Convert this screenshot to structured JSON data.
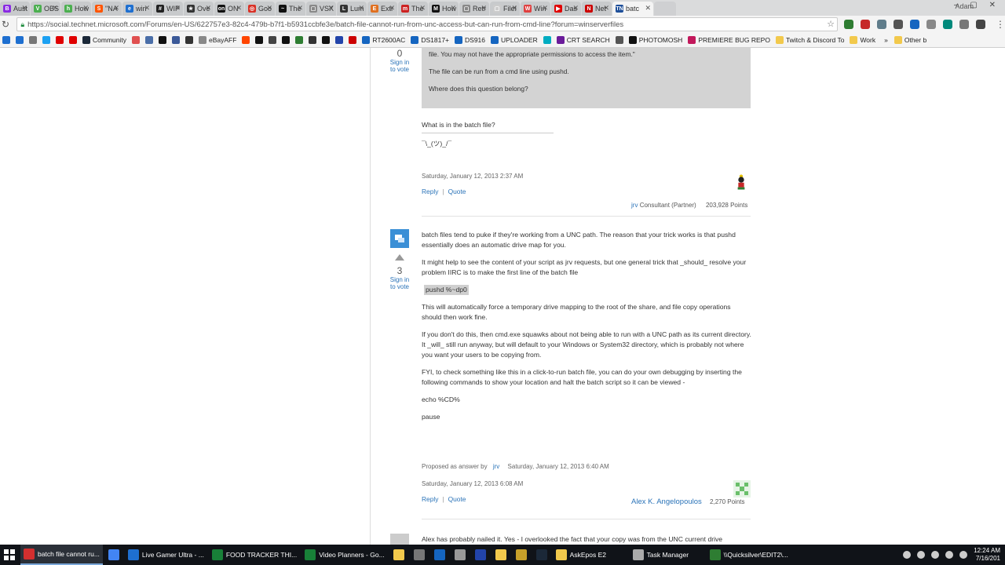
{
  "browser": {
    "tabs": [
      {
        "label": "Aust",
        "color": "#8a2be2",
        "glyph": "B"
      },
      {
        "label": "OBS",
        "color": "#4caf50",
        "glyph": "V"
      },
      {
        "label": "How",
        "color": "#4caf50",
        "glyph": "h"
      },
      {
        "label": "\"NA",
        "color": "#ff5500",
        "glyph": "S"
      },
      {
        "label": "win",
        "color": "#1e6fd0",
        "glyph": "e"
      },
      {
        "label": "WIP",
        "color": "#222222",
        "glyph": "#"
      },
      {
        "label": "Ove",
        "color": "#333333",
        "glyph": "★"
      },
      {
        "label": "ON",
        "color": "#111111",
        "glyph": "on"
      },
      {
        "label": "Goo",
        "color": "#d93025",
        "glyph": "◎"
      },
      {
        "label": "The",
        "color": "#111111",
        "glyph": "~"
      },
      {
        "label": "VSX",
        "color": "#888888",
        "glyph": "▢"
      },
      {
        "label": "Lum",
        "color": "#333333",
        "glyph": "L"
      },
      {
        "label": "Extr",
        "color": "#e07020",
        "glyph": "E"
      },
      {
        "label": "The",
        "color": "#cc2222",
        "glyph": "m"
      },
      {
        "label": "How",
        "color": "#111111",
        "glyph": "M"
      },
      {
        "label": "Retr",
        "color": "#888888",
        "glyph": "▢"
      },
      {
        "label": "FileI",
        "color": "#cccccc",
        "glyph": "▢"
      },
      {
        "label": "Win",
        "color": "#e04040",
        "glyph": "W"
      },
      {
        "label": "Das",
        "color": "#e00000",
        "glyph": "▶"
      },
      {
        "label": "Net",
        "color": "#cc0000",
        "glyph": "N"
      },
      {
        "label": "batc",
        "color": "#1e4f9a",
        "glyph": "TN"
      }
    ],
    "profile_name": "Adam",
    "window_controls": "– ▢ ✕",
    "url": "https://social.technet.microsoft.com/Forums/en-US/622757e3-82c4-479b-b7f1-b5931ccbfe3e/batch-file-cannot-run-from-unc-access-but-can-run-from-cmd-line?forum=winserverfiles",
    "extension_colors": [
      "#2e7d32",
      "#c62828",
      "#607d8b",
      "#555555",
      "#1565c0",
      "#888888",
      "#00897b",
      "#777777",
      "#444444"
    ],
    "bookmarks": [
      {
        "label": "",
        "color": "#1e6fd0"
      },
      {
        "label": "",
        "color": "#777777"
      },
      {
        "label": "",
        "color": "#1da1f2"
      },
      {
        "label": "",
        "color": "#e00000"
      },
      {
        "label": "",
        "color": "#e00000"
      },
      {
        "label": "Community",
        "color": "#1b2838"
      },
      {
        "label": "",
        "color": "#e05050"
      },
      {
        "label": "",
        "color": "#4a6ea8"
      },
      {
        "label": "",
        "color": "#111111"
      },
      {
        "label": "",
        "color": "#3b5998"
      },
      {
        "label": "",
        "color": "#333333"
      },
      {
        "label": "eBayAFF",
        "color": "#888888"
      },
      {
        "label": "",
        "color": "#ff4500"
      },
      {
        "label": "",
        "color": "#111111"
      },
      {
        "label": "",
        "color": "#444444"
      },
      {
        "label": "",
        "color": "#111111"
      },
      {
        "label": "",
        "color": "#2e7d32"
      },
      {
        "label": "",
        "color": "#333333"
      },
      {
        "label": "",
        "color": "#111111"
      },
      {
        "label": "",
        "color": "#2244aa"
      },
      {
        "label": "",
        "color": "#cc0000"
      },
      {
        "label": "RT2600AC",
        "color": "#1565c0"
      },
      {
        "label": "DS1817+",
        "color": "#1565c0"
      },
      {
        "label": "DS916",
        "color": "#1565c0"
      },
      {
        "label": "UPLOADER",
        "color": "#1565c0"
      },
      {
        "label": "",
        "color": "#00acc1"
      },
      {
        "label": "CRT SEARCH",
        "color": "#6a1b9a"
      },
      {
        "label": "",
        "color": "#555555"
      },
      {
        "label": "PHOTOMOSH",
        "color": "#111111"
      },
      {
        "label": "PREMIERE BUG REPO",
        "color": "#c2185b"
      },
      {
        "label": "Twitch & Discord To",
        "color": "#f2c94c"
      },
      {
        "label": "Work",
        "color": "#f2c94c"
      }
    ],
    "bookmarks_overflow": "»",
    "other_bookmarks": "Other b"
  },
  "posts": [
    {
      "votes": "0",
      "sign_in_to_vote": "Sign in\nto vote",
      "quote_lines": [
        "file.  You may not have the appropriate permissions to access the item.\"",
        "The file can be run from a cmd line using pushd.",
        "Where does this question belong?"
      ],
      "paragraphs": [
        "What is in the batch file?"
      ],
      "signature": "¯\\_(ツ)_/¯",
      "date": "Saturday, January 12, 2013 2:37 AM",
      "reply": "Reply",
      "quote": "Quote",
      "author": "jrv",
      "author_role": "Consultant (Partner)",
      "points": "203,928 Points"
    },
    {
      "votes": "3",
      "sign_in_to_vote": "Sign in\nto vote",
      "paragraphs": [
        "batch files tend to puke if they're working from a UNC path. The reason that your trick works is that pushd essentially does an automatic drive map for you.",
        "It might help to see the content of your script as jrv requests, but one general trick that _should_ resolve your problem IIRC is to make the first line of the batch file"
      ],
      "code": "pushd %~dp0",
      "paragraphs_after": [
        "This will automatically force a temporary drive mapping to the root of the share, and file copy operations should then work fine.",
        "If you don't do this, then cmd.exe squawks about not being able to run with a UNC path as its current directory. It _will_ still run anyway, but will default to your Windows or System32 directory, which is probably not where you want your users to be copying from.",
        "FYI, to check something like this in a click-to-run batch file, you can do your own debugging by inserting the following commands to show your location and halt the batch script so it can be viewed -",
        "echo %CD%",
        "pause"
      ],
      "proposed_label": "Proposed as answer by",
      "proposed_by": "jrv",
      "proposed_date": "Saturday, January 12, 2013 6:40 AM",
      "date": "Saturday, January 12, 2013 6:08 AM",
      "reply": "Reply",
      "quote": "Quote",
      "author": "Alex K. Angelopoulos",
      "points": "2,270 Points"
    },
    {
      "paragraph": "Alex has probably nailed it.  Yes - I overlooked the fact that your copy was from the UNC current drive"
    }
  ],
  "taskbar": {
    "items": [
      {
        "label": "batch file cannot ru...",
        "color": "#d32f2f",
        "active": true
      },
      {
        "label": "",
        "color": "#4285f4",
        "active": false
      },
      {
        "label": "Live Gamer Ultra - ...",
        "color": "#1e6fd0",
        "active": false
      },
      {
        "label": "FOOD TRACKER THI...",
        "color": "#188038",
        "active": false
      },
      {
        "label": "Video Planners - Go...",
        "color": "#188038",
        "active": false
      },
      {
        "label": "",
        "color": "#f2c94c",
        "active": false
      },
      {
        "label": "",
        "color": "#777777",
        "active": false
      },
      {
        "label": "",
        "color": "#1565c0",
        "active": false
      },
      {
        "label": "",
        "color": "#999999",
        "active": false
      },
      {
        "label": "",
        "color": "#2244aa",
        "active": false
      },
      {
        "label": "",
        "color": "#f2c94c",
        "active": false
      },
      {
        "label": "",
        "color": "#c7a02a",
        "active": false
      },
      {
        "label": "",
        "color": "#1b2838",
        "active": false
      },
      {
        "label": "AskEpos E2",
        "color": "#f2c94c",
        "active": false
      },
      {
        "label": "Task Manager",
        "color": "#aaaaaa",
        "active": false
      },
      {
        "label": "\\\\Quicksilver\\EDIT2\\...",
        "color": "#2e7d32",
        "active": false
      }
    ],
    "time": "12:24 AM",
    "date": "7/16/201"
  }
}
